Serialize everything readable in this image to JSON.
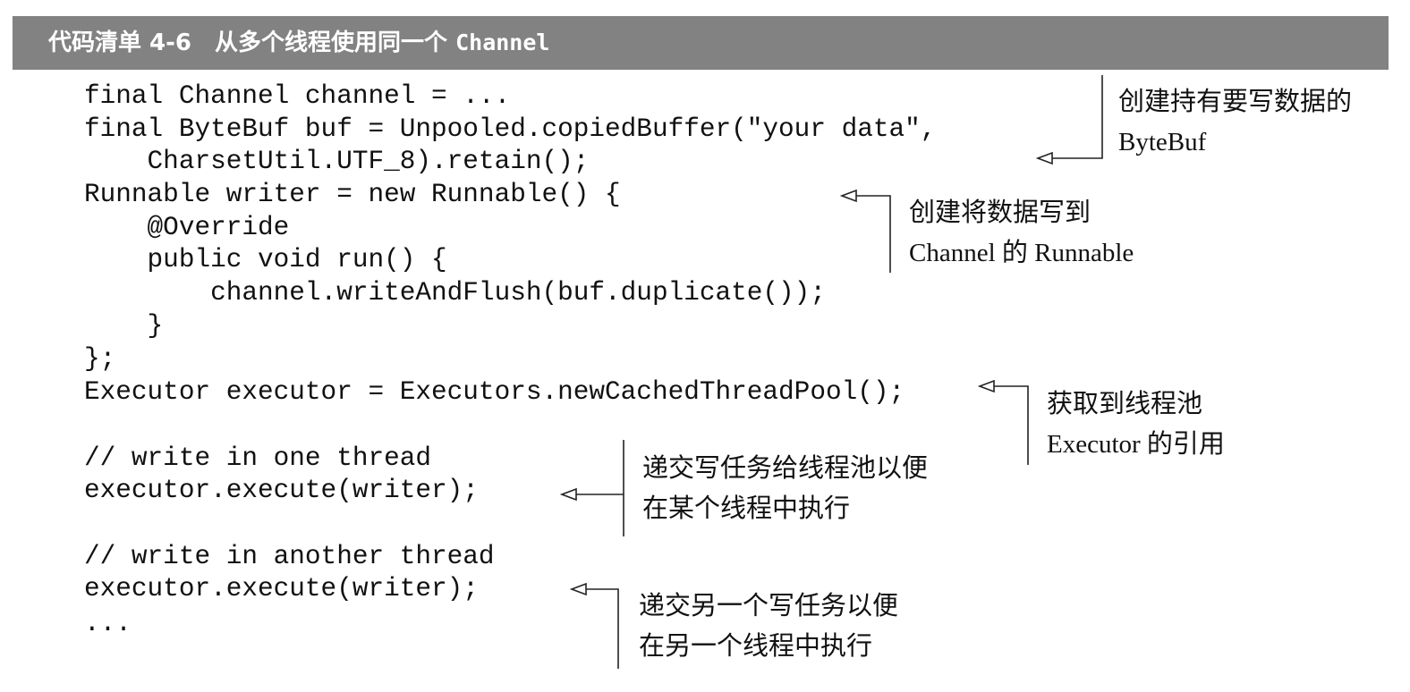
{
  "listing": {
    "title": "代码清单 4-6　从多个线程使用同一个",
    "title_code": "Channel"
  },
  "code_lines": [
    "final Channel channel = ...",
    "final ByteBuf buf = Unpooled.copiedBuffer(\"your data\",",
    "    CharsetUtil.UTF_8).retain();",
    "Runnable writer = new Runnable() {",
    "    @Override",
    "    public void run() {",
    "        channel.writeAndFlush(buf.duplicate());",
    "    }",
    "};",
    "Executor executor = Executors.newCachedThreadPool();",
    "// write in one thread",
    "executor.execute(writer);",
    "// write in another thread",
    "executor.execute(writer);",
    "..."
  ],
  "annotations": [
    {
      "line1": "创建持有要写数据的",
      "line2": "ByteBuf"
    },
    {
      "line1": "创建将数据写到",
      "line2": "Channel 的 Runnable"
    },
    {
      "line1": "获取到线程池",
      "line2": "Executor 的引用"
    },
    {
      "line1": "递交写任务给线程池以便",
      "line2": "在某个线程中执行"
    },
    {
      "line1": "递交另一个写任务以便",
      "line2": "在另一个线程中执行"
    }
  ],
  "colors": {
    "title_bar": "#828282",
    "title_text": "#ffffff",
    "text": "#111111",
    "leader_line": "#222222"
  }
}
